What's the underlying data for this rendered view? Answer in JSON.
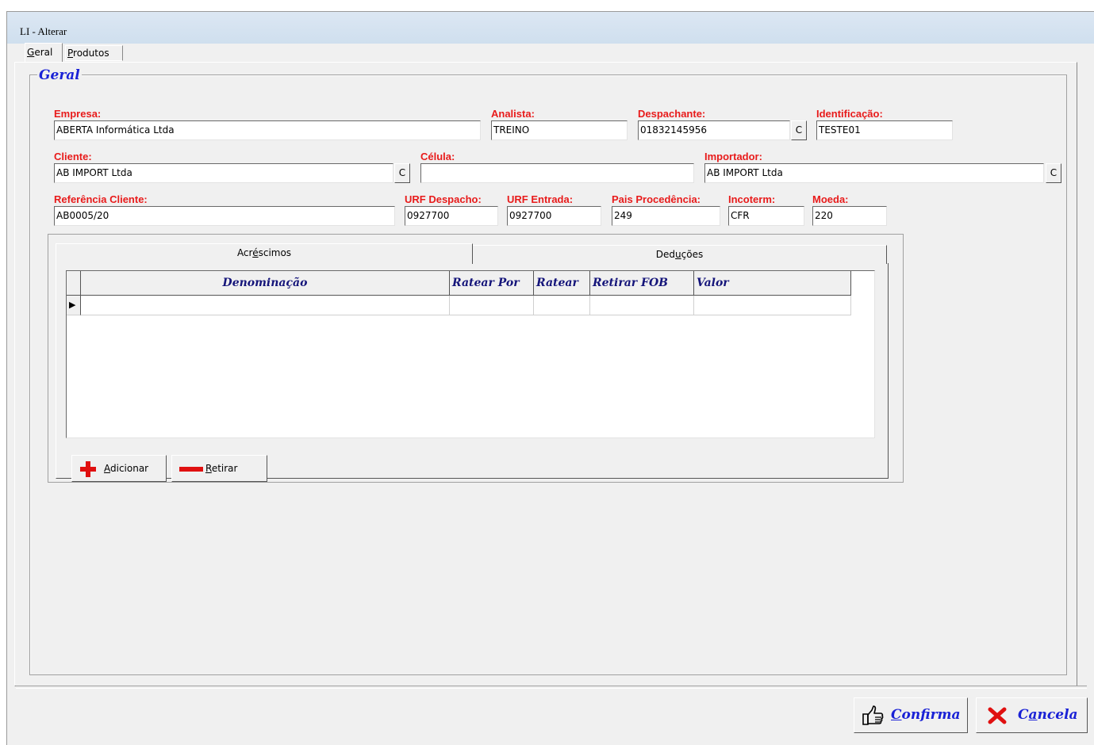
{
  "window": {
    "title": "LI - Alterar"
  },
  "tabs": [
    {
      "label_pre": "",
      "label_u": "G",
      "label_post": "eral"
    },
    {
      "label_pre": "",
      "label_u": "P",
      "label_post": "rodutos"
    }
  ],
  "group": {
    "title": "Geral"
  },
  "form": {
    "empresa": {
      "label": "Empresa:",
      "value": "ABERTA Informática Ltda"
    },
    "analista": {
      "label": "Analista:",
      "value": "TREINO"
    },
    "despachante": {
      "label": "Despachante:",
      "value": "01832145956"
    },
    "identificacao": {
      "label": "Identificação:",
      "value": "TESTE01"
    },
    "cliente": {
      "label": "Cliente:",
      "value": "AB IMPORT Ltda"
    },
    "celula": {
      "label": "Célula:",
      "value": ""
    },
    "importador": {
      "label": "Importador:",
      "value": "AB IMPORT Ltda"
    },
    "referencia_cliente": {
      "label": "Referência Cliente:",
      "value": "AB0005/20"
    },
    "urf_despacho": {
      "label": "URF Despacho:",
      "value": "0927700"
    },
    "urf_entrada": {
      "label": "URF Entrada:",
      "value": "0927700"
    },
    "pais_procedencia": {
      "label": "Pais Procedência:",
      "value": "249"
    },
    "incoterm": {
      "label": "Incoterm:",
      "value": "CFR"
    },
    "moeda": {
      "label": "Moeda:",
      "value": "220"
    },
    "lookup_button": "C"
  },
  "inner_tabs": [
    {
      "pre": "Acr",
      "u": "é",
      "post": "scimos"
    },
    {
      "pre": "Ded",
      "u": "u",
      "post": "ções"
    }
  ],
  "grid": {
    "columns": [
      "Denominação",
      "Ratear Por",
      "Ratear",
      "Retirar FOB",
      "Valor"
    ],
    "row_indicator": "▶"
  },
  "buttons": {
    "adicionar": {
      "pre": "",
      "u": "A",
      "post": "dicionar",
      "icon": "plus-icon"
    },
    "retirar": {
      "pre": "",
      "u": "R",
      "post": "etirar",
      "icon": "minus-icon"
    },
    "confirma": {
      "pre": "",
      "u": "C",
      "post": "onfirma",
      "icon": "thumbs-up-icon"
    },
    "cancela": {
      "pre": "C",
      "u": "a",
      "post": "ncela",
      "icon": "x-icon"
    }
  },
  "colors": {
    "label_red": "#e81b1b",
    "title_blue": "#1a22d6",
    "header_navy": "#15157a"
  }
}
